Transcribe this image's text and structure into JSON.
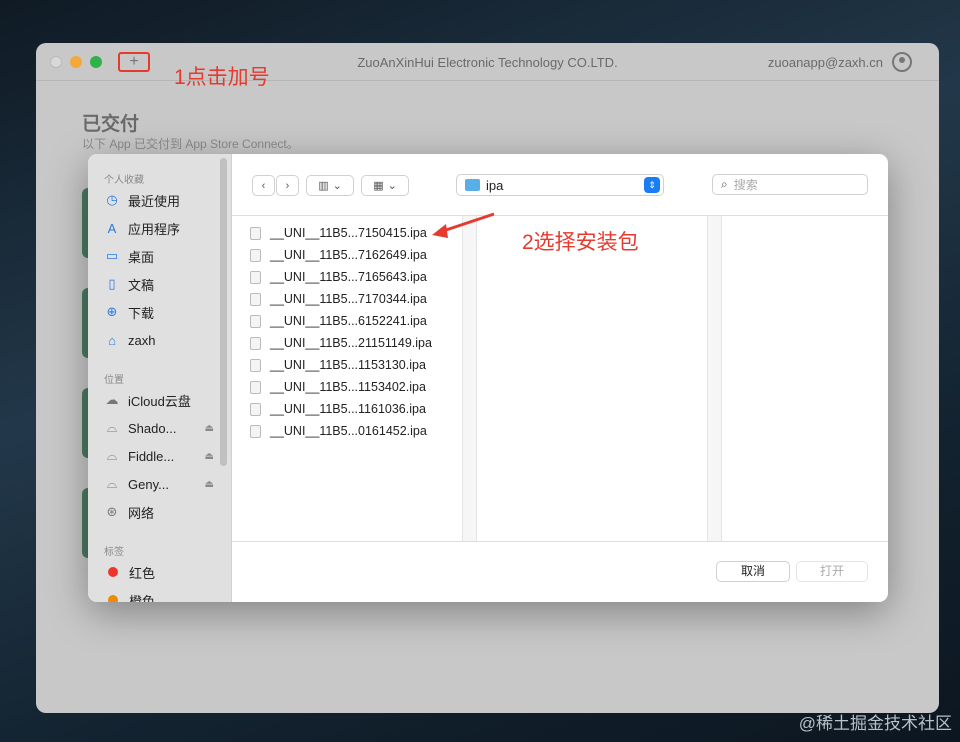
{
  "window": {
    "title": "ZuoAnXinHui Electronic Technology CO.LTD.",
    "account": "zuoanapp@zaxh.cn",
    "add_button": "+",
    "heading": "已交付",
    "subtitle": "以下 App 已交付到 App Store Connect。"
  },
  "annotations": {
    "step1": "1点击加号",
    "step2": "2选择安装包"
  },
  "sidebar": {
    "favorites_header": "个人收藏",
    "favorites": [
      {
        "label": "最近使用",
        "icon": "clock-icon"
      },
      {
        "label": "应用程序",
        "icon": "apps-icon"
      },
      {
        "label": "桌面",
        "icon": "desktop-icon"
      },
      {
        "label": "文稿",
        "icon": "document-icon"
      },
      {
        "label": "下载",
        "icon": "download-icon"
      },
      {
        "label": "zaxh",
        "icon": "home-icon"
      }
    ],
    "locations_header": "位置",
    "locations": [
      {
        "label": "iCloud云盘",
        "icon": "cloud-icon"
      },
      {
        "label": "Shado...",
        "icon": "disk-icon"
      },
      {
        "label": "Fiddle...",
        "icon": "disk-icon"
      },
      {
        "label": "Geny...",
        "icon": "disk-icon"
      },
      {
        "label": "网络",
        "icon": "network-icon"
      }
    ],
    "tags_header": "标签",
    "tags": [
      {
        "label": "红色",
        "color": "#f0342c"
      },
      {
        "label": "橙色",
        "color": "#f08a00"
      }
    ]
  },
  "toolbar": {
    "folder": "ipa",
    "search_placeholder": "搜索"
  },
  "files": [
    "__UNI__11B5...7150415.ipa",
    "__UNI__11B5...7162649.ipa",
    "__UNI__11B5...7165643.ipa",
    "__UNI__11B5...7170344.ipa",
    "__UNI__11B5...6152241.ipa",
    "__UNI__11B5...21151149.ipa",
    "__UNI__11B5...1153130.ipa",
    "__UNI__11B5...1153402.ipa",
    "__UNI__11B5...1161036.ipa",
    "__UNI__11B5...0161452.ipa"
  ],
  "buttons": {
    "cancel": "取消",
    "open": "打开"
  },
  "watermark": "@稀土掘金技术社区"
}
